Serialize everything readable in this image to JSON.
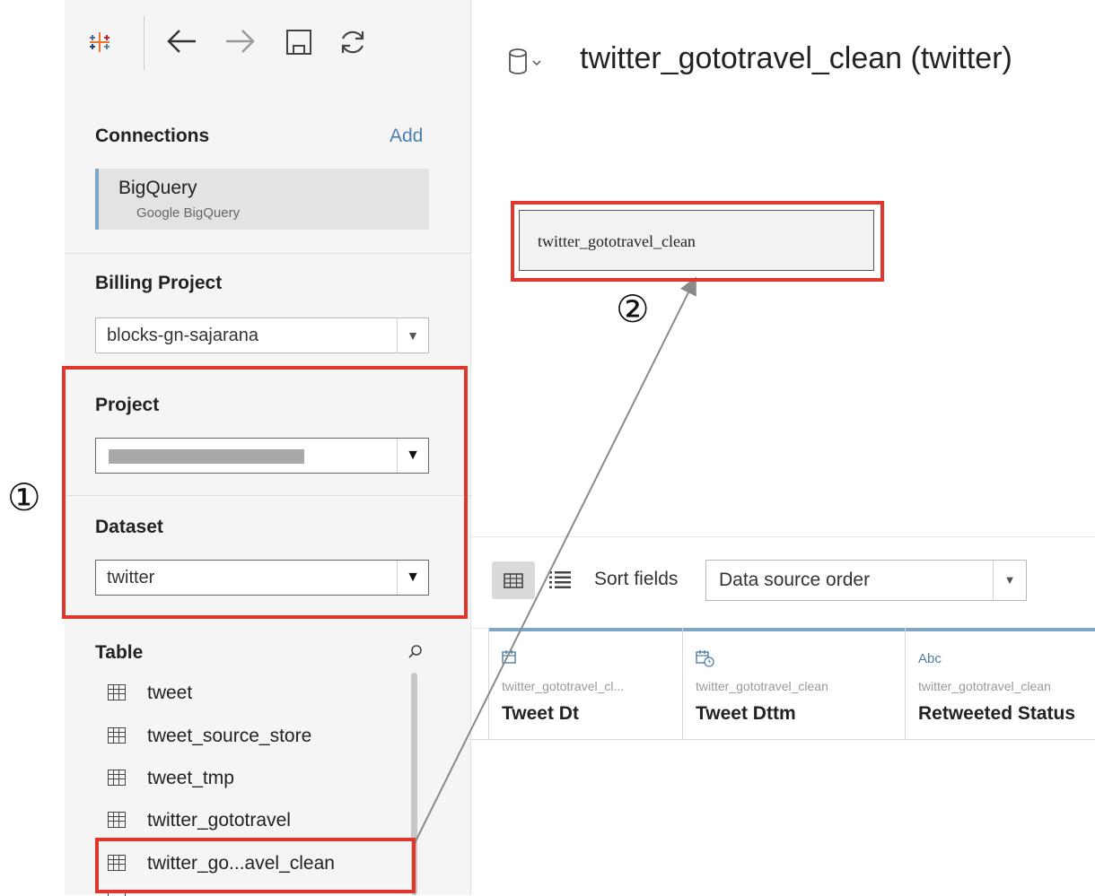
{
  "toolbar": {
    "logo_icon": "tableau-logo-icon",
    "back_icon": "arrow-left-icon",
    "forward_icon": "arrow-right-icon",
    "save_icon": "save-icon",
    "refresh_icon": "refresh-icon"
  },
  "connections": {
    "title": "Connections",
    "add_label": "Add",
    "item_name": "BigQuery",
    "item_type": "Google BigQuery"
  },
  "billing_project": {
    "title": "Billing Project",
    "value": "blocks-gn-sajarana"
  },
  "project": {
    "title": "Project",
    "value": ""
  },
  "dataset": {
    "title": "Dataset",
    "value": "twitter"
  },
  "table": {
    "title": "Table",
    "items": [
      "tweet",
      "tweet_source_store",
      "tweet_tmp",
      "twitter_gototravel",
      "twitter_go...avel_clean"
    ]
  },
  "datasource": {
    "title": "twitter_gototravel_clean (twitter)"
  },
  "canvas": {
    "table_label": "twitter_gototravel_clean"
  },
  "fields_toolbar": {
    "sort_label": "Sort fields",
    "sort_value": "Data source order"
  },
  "fields": [
    {
      "type": "date-icon",
      "source": "twitter_gototravel_cl...",
      "name": "Tweet Dt"
    },
    {
      "type": "datetime-icon",
      "source": "twitter_gototravel_clean",
      "name": "Tweet Dttm"
    },
    {
      "type": "Abc",
      "source": "twitter_gototravel_clean",
      "name": "Retweeted Status"
    }
  ],
  "annotations": {
    "callout_1": "①",
    "callout_2": "②"
  },
  "colors": {
    "highlight": "#e2362c",
    "accent": "#4e7ea8",
    "sidebar_bg": "#f5f5f5"
  }
}
